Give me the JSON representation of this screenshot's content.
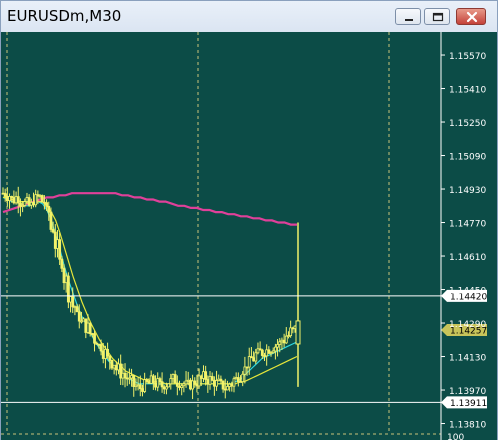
{
  "window": {
    "title": "EURUSDm,M30",
    "buttons": [
      "minimize",
      "restore",
      "close"
    ]
  },
  "colors": {
    "background": "#0c4c47",
    "grid": "#c9c27a",
    "candles": "#f2f26a",
    "ma_fast": "#2fd7e0",
    "ma_medium": "#e6e63a",
    "ma_slow": "#e0409a",
    "price_line": "#ffffff",
    "axis_text": "#ffffff"
  },
  "chart_data": {
    "type": "candlestick",
    "symbol": "EURUSDm",
    "timeframe": "M30",
    "y_ticks": [
      "1.15570",
      "1.15410",
      "1.15250",
      "1.15090",
      "1.14930",
      "1.14770",
      "1.14610",
      "1.14450",
      "1.14290",
      "1.14130",
      "1.13970",
      "1.13810"
    ],
    "ylim": [
      1.1376,
      1.1568
    ],
    "price_markers": [
      {
        "value": "1.14420",
        "style": "white-label",
        "line": true
      },
      {
        "value": "1.14257",
        "style": "yellow-label",
        "line": false
      },
      {
        "value": "1.13911",
        "style": "white-label",
        "line": true
      }
    ],
    "bottom_edge_label": "100",
    "close_series_approx": [
      1.1491,
      1.149,
      1.1488,
      1.1489,
      1.1487,
      1.1486,
      1.1485,
      1.1488,
      1.1489,
      1.1487,
      1.1482,
      1.1474,
      1.1466,
      1.1458,
      1.145,
      1.1442,
      1.1437,
      1.1432,
      1.1429,
      1.1427,
      1.1424,
      1.1421,
      1.1418,
      1.1415,
      1.1412,
      1.141,
      1.1407,
      1.1405,
      1.1403,
      1.1401,
      1.1399,
      1.1398,
      1.1399,
      1.14,
      1.1401,
      1.14,
      1.1399,
      1.14,
      1.1401,
      1.1402,
      1.1401,
      1.14,
      1.1399,
      1.14,
      1.1401,
      1.1402,
      1.1403,
      1.1402,
      1.1401,
      1.14,
      1.1399,
      1.1398,
      1.14,
      1.1402,
      1.1404,
      1.1407,
      1.141,
      1.1412,
      1.1414,
      1.1415,
      1.1416,
      1.1417,
      1.1418,
      1.1419,
      1.1421,
      1.1423,
      1.1425,
      1.1426
    ],
    "moving_averages": [
      {
        "name": "fast",
        "color": "#2fd7e0",
        "values": [
          1.1489,
          1.1488,
          1.1487,
          1.1487,
          1.1486,
          1.1485,
          1.1485,
          1.1486,
          1.1487,
          1.1486,
          1.1483,
          1.1478,
          1.1471,
          1.1464,
          1.1456,
          1.1449,
          1.1443,
          1.1437,
          1.1432,
          1.1428,
          1.1424,
          1.142,
          1.1417,
          1.1414,
          1.1411,
          1.1409,
          1.1407,
          1.1405,
          1.1403,
          1.1402,
          1.1401,
          1.14,
          1.14,
          1.14,
          1.14,
          1.14,
          1.14,
          1.14,
          1.14,
          1.14,
          1.14,
          1.14,
          1.14,
          1.14,
          1.14,
          1.14,
          1.14,
          1.14,
          1.14,
          1.14,
          1.14,
          1.14,
          1.14,
          1.1401,
          1.1402,
          1.1404,
          1.1406,
          1.1408,
          1.141,
          1.1412,
          1.1413,
          1.1414,
          1.1415,
          1.1416,
          1.1417,
          1.1418,
          1.1419,
          1.142
        ]
      },
      {
        "name": "medium",
        "color": "#e6e63a",
        "values": [
          1.1489,
          1.1489,
          1.1488,
          1.1488,
          1.1487,
          1.1487,
          1.1486,
          1.1486,
          1.1487,
          1.1487,
          1.1485,
          1.1482,
          1.1478,
          1.1472,
          1.1465,
          1.1458,
          1.1451,
          1.1445,
          1.1439,
          1.1434,
          1.1429,
          1.1425,
          1.1421,
          1.1418,
          1.1415,
          1.1412,
          1.141,
          1.1408,
          1.1406,
          1.1405,
          1.1404,
          1.1403,
          1.1402,
          1.1402,
          1.1401,
          1.1401,
          1.1401,
          1.14,
          1.14,
          1.14,
          1.14,
          1.14,
          1.14,
          1.14,
          1.14,
          1.14,
          1.14,
          1.14,
          1.14,
          1.14,
          1.14,
          1.14,
          1.14,
          1.14,
          1.1401,
          1.1401,
          1.1402,
          1.1403,
          1.1404,
          1.1405,
          1.1406,
          1.1407,
          1.1408,
          1.1409,
          1.141,
          1.1411,
          1.1412,
          1.1413
        ]
      },
      {
        "name": "slow",
        "color": "#e0409a",
        "values": [
          1.1482,
          1.1483,
          1.1484,
          1.1485,
          1.1486,
          1.1487,
          1.1488,
          1.1489,
          1.1489,
          1.149,
          1.149,
          1.1491,
          1.1491,
          1.1491,
          1.1491,
          1.1491,
          1.1491,
          1.1491,
          1.1491,
          1.149,
          1.149,
          1.1489,
          1.1489,
          1.1488,
          1.1488,
          1.1487,
          1.1487,
          1.1486,
          1.1485,
          1.1485,
          1.1484,
          1.1484,
          1.1483,
          1.1483,
          1.1482,
          1.1482,
          1.1481,
          1.1481,
          1.148,
          1.148,
          1.1479,
          1.1479,
          1.1478,
          1.1478,
          1.1477,
          1.1477,
          1.1476,
          1.1476
        ]
      }
    ]
  }
}
